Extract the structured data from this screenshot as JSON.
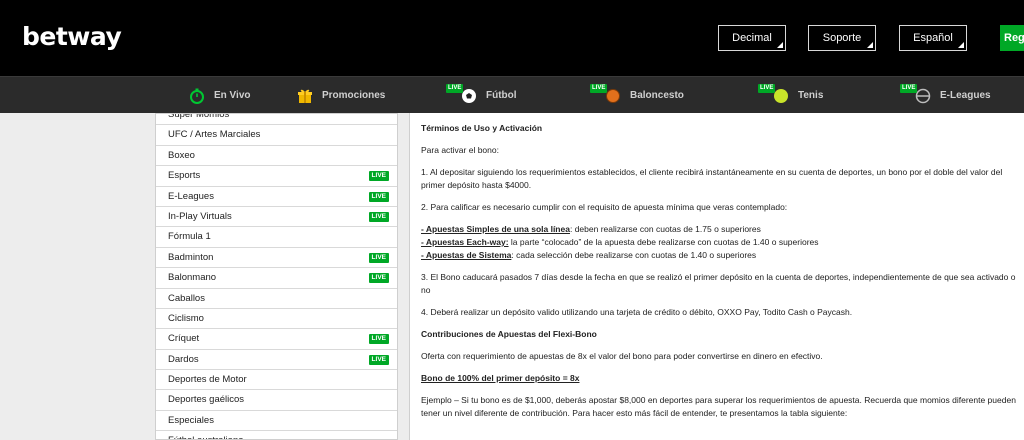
{
  "header": {
    "logo": "betway",
    "buttons": [
      "Decimal",
      "Soporte",
      "Español"
    ],
    "register_label": "Regi"
  },
  "nav": {
    "live_badge": "LIVE",
    "items": [
      {
        "label": "En Vivo",
        "icon": "stopwatch-icon"
      },
      {
        "label": "Promociones",
        "icon": "gift-icon"
      },
      {
        "label": "Fútbol",
        "icon": "soccer-ball-icon",
        "live": true
      },
      {
        "label": "Baloncesto",
        "icon": "basketball-icon",
        "live": true
      },
      {
        "label": "Tenis",
        "icon": "tennis-ball-icon",
        "live": true
      },
      {
        "label": "E-Leagues",
        "icon": "esports-icon",
        "live": true
      }
    ]
  },
  "sidebar": {
    "live_badge": "LIVE",
    "items": [
      {
        "label": "Súper Momios",
        "live": false
      },
      {
        "label": "UFC / Artes Marciales",
        "live": false
      },
      {
        "label": "Boxeo",
        "live": false
      },
      {
        "label": "Esports",
        "live": true
      },
      {
        "label": "E-Leagues",
        "live": true
      },
      {
        "label": "In-Play Virtuals",
        "live": true
      },
      {
        "label": "Fórmula 1",
        "live": false
      },
      {
        "label": "Badminton",
        "live": true
      },
      {
        "label": "Balonmano",
        "live": true
      },
      {
        "label": "Caballos",
        "live": false
      },
      {
        "label": "Ciclismo",
        "live": false
      },
      {
        "label": "Críquet",
        "live": true
      },
      {
        "label": "Dardos",
        "live": true
      },
      {
        "label": "Deportes de Motor",
        "live": false
      },
      {
        "label": "Deportes gaélicos",
        "live": false
      },
      {
        "label": "Especiales",
        "live": false
      },
      {
        "label": "Fútbol australiano",
        "live": false
      }
    ]
  },
  "content": {
    "terms_title": "Términos de Uso y Activación",
    "activate_intro": "Para activar el bono:",
    "step1": "1. Al depositar siguiendo los requerimientos establecidos, el cliente recibirá instantáneamente en su cuenta de deportes, un bono por el doble del valor del primer depósito hasta $4000.",
    "step2": "2. Para calificar es necesario cumplir con el requisito de apuesta mínima que veras contemplado:",
    "bet_simple_label": "- Apuestas Simples de una sola línea",
    "bet_simple_text": ": deben realizarse con cuotas de 1.75 o superiores",
    "bet_each_label": "- Apuestas Each-way:",
    "bet_each_text": " la parte “colocado” de la apuesta debe realizarse con cuotas de 1.40 o superiores",
    "bet_system_label": "- Apuestas de Sistema",
    "bet_system_text": ": cada selección debe realizarse con cuotas de 1.40 o superiores",
    "step3": "3. El Bono caducará pasados 7 días desde la fecha en que se realizó el primer depósito en la cuenta de deportes, independientemente de que sea activado o no",
    "step4": "4. Deberá realizar un depósito valido utilizando una tarjeta de crédito o débito, OXXO Pay, Todito Cash o Paycash.",
    "contrib_title": "Contribuciones de Apuestas del Flexi-Bono",
    "contrib_text": "Oferta con requerimiento de apuestas de 8x el valor del bono para poder convertirse en dinero en efectivo.",
    "bonus_heading": "Bono de 100% del primer depósito = 8x",
    "example_text": "Ejemplo – Si tu bono es de $1,000, deberás apostar $8,000 en deportes para superar los requerimientos de apuesta. Recuerda que momios diferente pueden tener un nivel diferente de contribución. Para hacer esto más fácil de entender, te presentamos la tabla siguiente:"
  }
}
